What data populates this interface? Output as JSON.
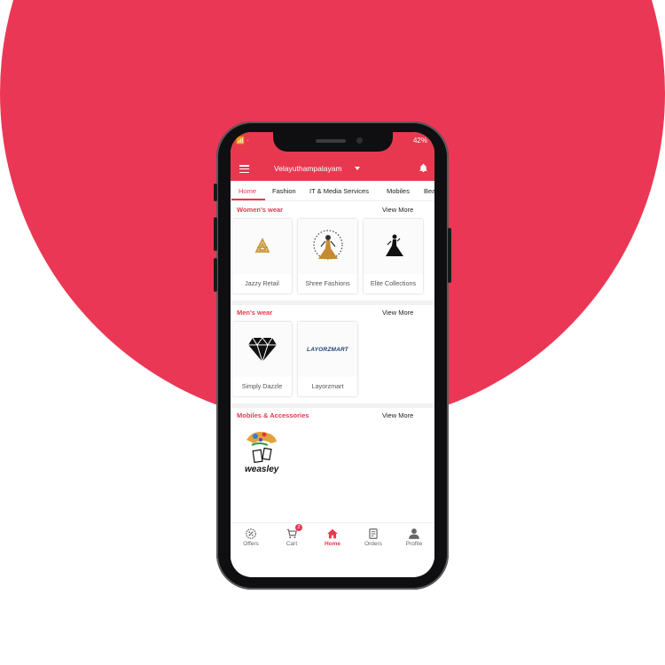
{
  "colors": {
    "accent": "#e8384f",
    "background_shape": "#ea3755",
    "phone_frame": "#0f0f11"
  },
  "status_bar": {
    "left": "📶 ·",
    "right": "42%"
  },
  "header": {
    "location": "Velayuthampalayam"
  },
  "tabs": [
    {
      "label": "Home",
      "active": true
    },
    {
      "label": "Fashion"
    },
    {
      "label": "IT & Media Services"
    },
    {
      "label": "Mobiles"
    },
    {
      "label": "Bea"
    }
  ],
  "sections": [
    {
      "title": "Women's wear",
      "view_more": "View More",
      "stores": [
        {
          "name": "Jazzy Retail",
          "icon": "jazzy-retail-logo"
        },
        {
          "name": "Shree Fashions",
          "icon": "shree-fashions-logo"
        },
        {
          "name": "Elite Collections",
          "icon": "elite-collections-logo"
        }
      ]
    },
    {
      "title": "Men's wear",
      "view_more": "View More",
      "stores": [
        {
          "name": "Simply Dazzle",
          "icon": "simply-dazzle-logo"
        },
        {
          "name": "Layorzmart",
          "icon": "layorzmart-logo",
          "logo_text": "LAYORZMART"
        }
      ]
    },
    {
      "title": "Mobiles & Accessories",
      "view_more": "View More",
      "stores": [
        {
          "name": "",
          "icon": "weasley-logo",
          "logo_text": "weasley"
        }
      ]
    }
  ],
  "bottom_nav": [
    {
      "label": "Offers",
      "icon": "offers-icon"
    },
    {
      "label": "Cart",
      "icon": "cart-icon",
      "badge": "2"
    },
    {
      "label": "Home",
      "icon": "home-icon",
      "active": true
    },
    {
      "label": "Orders",
      "icon": "orders-icon"
    },
    {
      "label": "Profile",
      "icon": "profile-icon"
    }
  ]
}
